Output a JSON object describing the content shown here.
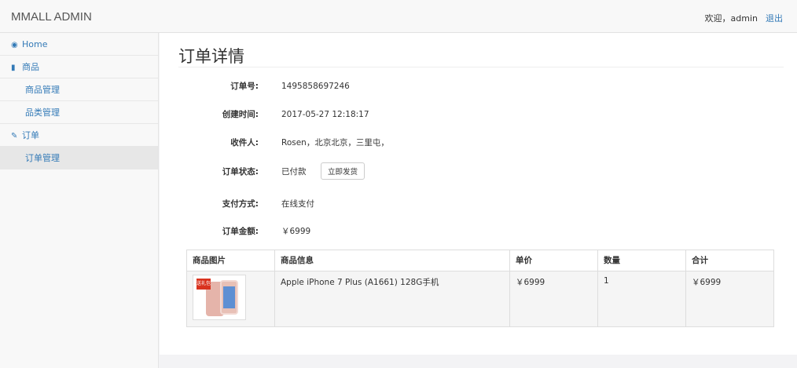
{
  "header": {
    "brand": "MMALL ADMIN",
    "welcome": "欢迎，admin",
    "logout": "退出"
  },
  "sidebar": {
    "home": {
      "label": "Home",
      "icon": "dashboard-icon"
    },
    "products": {
      "label": "商品",
      "icon": "bar-chart-icon"
    },
    "product_manage": "商品管理",
    "category_manage": "品类管理",
    "orders": {
      "label": "订单",
      "icon": "wrench-icon"
    },
    "order_manage": "订单管理"
  },
  "page": {
    "title": "订单详情"
  },
  "order": {
    "number_label": "订单号:",
    "number": "1495858697246",
    "created_label": "创建时间:",
    "created": "2017-05-27 12:18:17",
    "receiver_label": "收件人:",
    "receiver": "Rosen，北京北京，三里屯，",
    "status_label": "订单状态:",
    "status": "已付款",
    "ship_button": "立即发货",
    "payment_label": "支付方式:",
    "payment": "在线支付",
    "amount_label": "订单金额:",
    "amount": "￥6999"
  },
  "items_table": {
    "headers": [
      "商品图片",
      "商品信息",
      "单价",
      "数量",
      "合计"
    ],
    "rows": [
      {
        "image_tag": "送礼包",
        "info": "Apple iPhone 7 Plus (A1661) 128G手机",
        "price": "￥6999",
        "quantity": "1",
        "total": "￥6999"
      }
    ]
  }
}
